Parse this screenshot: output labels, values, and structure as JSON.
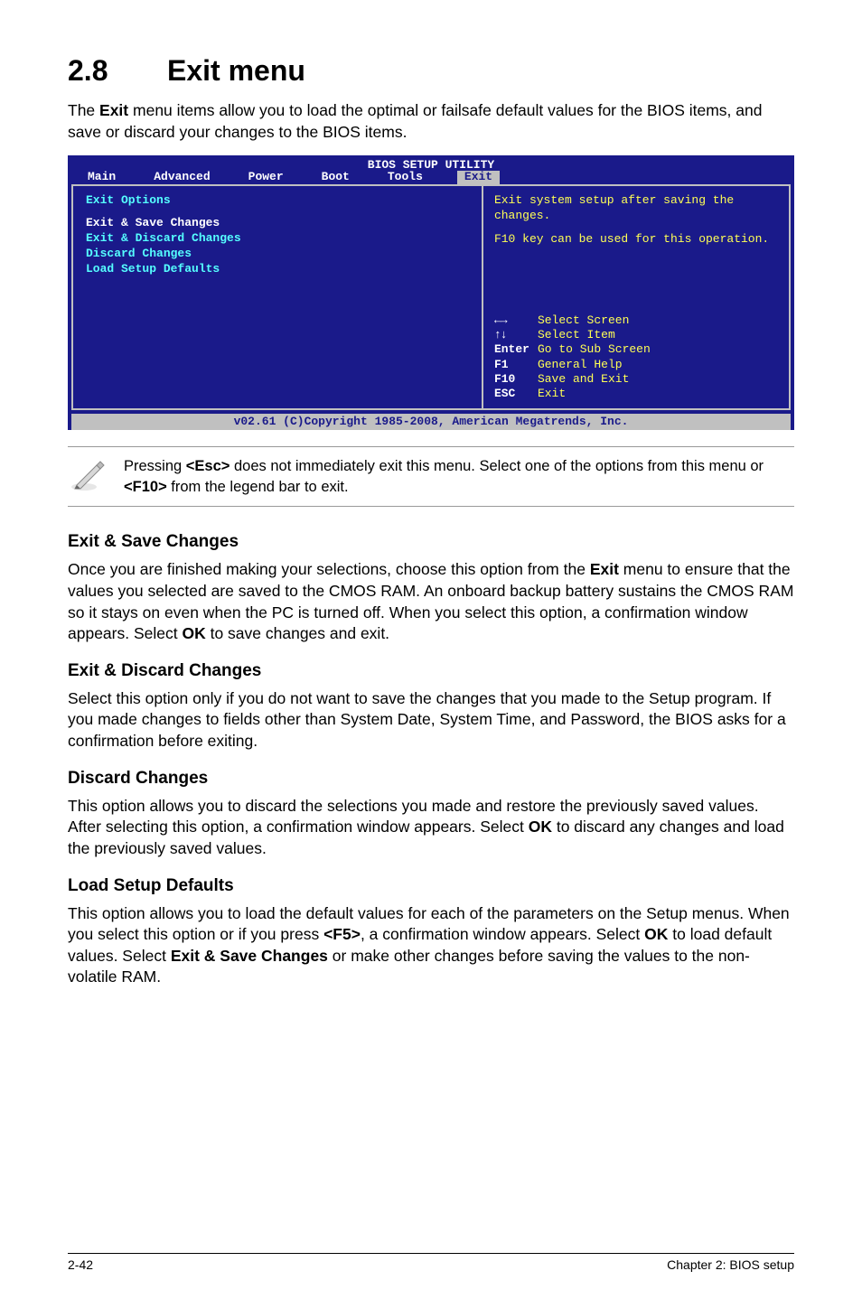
{
  "section": {
    "number": "2.8",
    "title": "Exit menu",
    "intro_pre": "The ",
    "intro_bold": "Exit",
    "intro_post": " menu items allow you to load the optimal or failsafe default values for the BIOS items, and save or discard your changes to the BIOS items."
  },
  "bios": {
    "title": "BIOS SETUP UTILITY",
    "tabs": [
      "Main",
      "Advanced",
      "Power",
      "Boot",
      "Tools",
      "Exit"
    ],
    "active_tab": "Exit",
    "left": {
      "headline": "Exit Options",
      "selected": "Exit & Save Changes",
      "options": [
        "Exit & Discard Changes",
        "Discard Changes",
        "",
        "Load Setup Defaults"
      ]
    },
    "help": {
      "line1": "Exit system setup after saving the changes.",
      "line2": "F10 key can be used for this operation."
    },
    "keys": [
      {
        "k": "←→",
        "label": "Select Screen",
        "arrows": true
      },
      {
        "k": "↑↓",
        "label": "Select Item",
        "arrows": true
      },
      {
        "k": "Enter",
        "label": "Go to Sub Screen"
      },
      {
        "k": "F1",
        "label": "General Help"
      },
      {
        "k": "F10",
        "label": "Save and Exit"
      },
      {
        "k": "ESC",
        "label": "Exit"
      }
    ],
    "footer": "v02.61 (C)Copyright 1985-2008, American Megatrends, Inc."
  },
  "note": {
    "pre": "Pressing ",
    "esc": "<Esc>",
    "mid": " does not immediately exit this menu. Select one of the options from this menu or ",
    "f10": "<F10>",
    "post": " from the legend bar to exit."
  },
  "subs": {
    "save": {
      "title": "Exit & Save Changes",
      "p1a": "Once you are finished making your selections, choose this option from the ",
      "p1b": "Exit",
      "p1c": " menu to ensure that the values you selected are saved to the CMOS RAM. An onboard backup battery sustains the CMOS RAM so it stays on even when the PC is turned off. When you select this option, a confirmation window appears. Select ",
      "p1d": "OK",
      "p1e": " to save changes and exit."
    },
    "discard_exit": {
      "title": "Exit & Discard Changes",
      "p": "Select this option only if you do not want to save the changes that you  made to the Setup program. If you made changes to fields other than System Date, System Time, and Password, the BIOS asks for a confirmation before exiting."
    },
    "discard": {
      "title": "Discard Changes",
      "p1a": "This option allows you to discard the selections you made and restore the previously saved values. After selecting this option, a confirmation window appears. Select ",
      "p1b": "OK",
      "p1c": " to discard any changes and load the previously saved values."
    },
    "load": {
      "title": "Load Setup Defaults",
      "p1a": "This option allows you to load the default values for each of the parameters on the Setup menus. When you select this option or if you press ",
      "p1b": "<F5>",
      "p1c": ", a confirmation window appears. Select ",
      "p1d": "OK",
      "p1e": " to load default values. Select ",
      "p1f": "Exit & Save Changes",
      "p1g": " or make other changes before saving the values to the non-volatile RAM."
    }
  },
  "footer": {
    "left": "2-42",
    "right": "Chapter 2: BIOS setup"
  }
}
